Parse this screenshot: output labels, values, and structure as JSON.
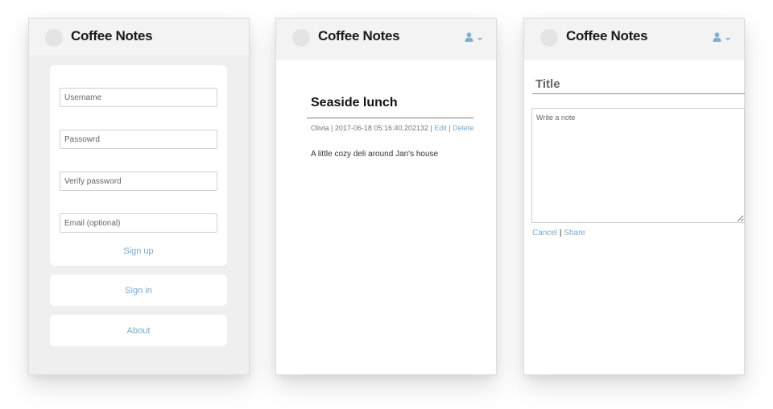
{
  "app": {
    "title": "Coffee Notes"
  },
  "colors": {
    "link": "#7aa9ca",
    "header_bg": "#f3f3f3",
    "panel_bg": "#efefef",
    "user_icon": "#7fb0cf"
  },
  "icons": {
    "user": "user-icon",
    "dropdown": "chevron-down-icon",
    "logo": "logo-icon"
  },
  "signup": {
    "username_placeholder": "Username",
    "password_placeholder": "Passowrd",
    "verify_placeholder": "Verify password",
    "email_placeholder": "Email (optional)",
    "signup_label": "Sign up",
    "signin_label": "Sign in",
    "about_label": "About"
  },
  "note": {
    "title": "Seaside lunch",
    "author": "Olivia",
    "separator": "|",
    "timestamp": "2017-06-18 05:16:40.202132",
    "edit_label": "Edit",
    "delete_label": "Delete",
    "body": "A little cozy deli around Jan's house"
  },
  "editor": {
    "title_placeholder": "Title",
    "note_placeholder": "Write a note",
    "cancel_label": "Cancel",
    "separator": "|",
    "share_label": "Share"
  }
}
